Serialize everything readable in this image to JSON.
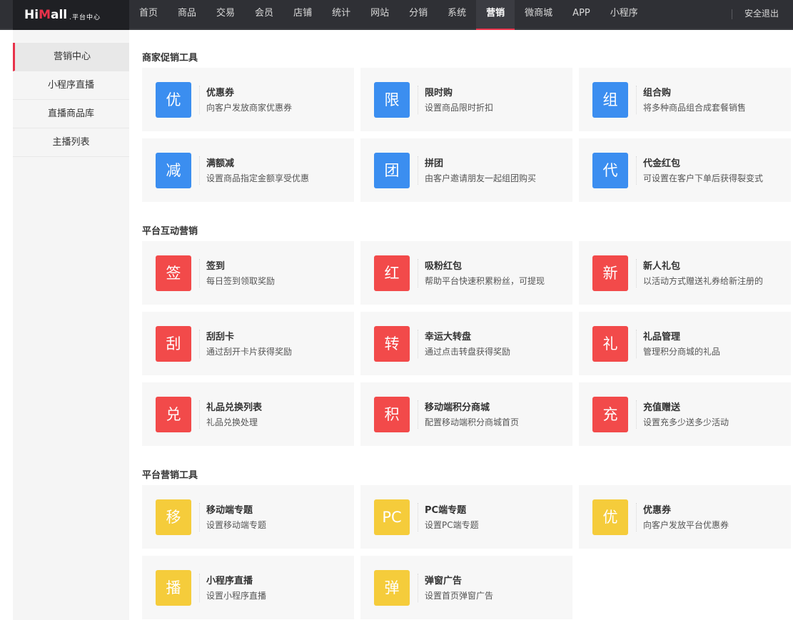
{
  "header": {
    "logo_brand_a": "Hi",
    "logo_brand_b": "M",
    "logo_brand_c": "all",
    "logo_suffix": ".平台中心",
    "nav": [
      "首页",
      "商品",
      "交易",
      "会员",
      "店铺",
      "统计",
      "网站",
      "分销",
      "系统",
      "营销",
      "微商城",
      "APP",
      "小程序"
    ],
    "active_nav": "营销",
    "logout": "安全退出"
  },
  "sidebar": {
    "items": [
      "营销中心",
      "小程序直播",
      "直播商品库",
      "主播列表"
    ],
    "active": "营销中心"
  },
  "sections": [
    {
      "title": "商家促销工具",
      "color": "#3b8ef0",
      "cards": [
        {
          "icon": "优",
          "icon_name": "coupon-icon",
          "title": "优惠券",
          "desc": "向客户发放商家优惠券"
        },
        {
          "icon": "限",
          "icon_name": "flash-sale-icon",
          "title": "限时购",
          "desc": "设置商品限时折扣"
        },
        {
          "icon": "组",
          "icon_name": "bundle-icon",
          "title": "组合购",
          "desc": "将多种商品组合成套餐销售"
        },
        {
          "icon": "减",
          "icon_name": "discount-icon",
          "title": "满额减",
          "desc": "设置商品指定金额享受优惠"
        },
        {
          "icon": "团",
          "icon_name": "group-buy-icon",
          "title": "拼团",
          "desc": "由客户邀请朋友一起组团购买"
        },
        {
          "icon": "代",
          "icon_name": "voucher-icon",
          "title": "代金红包",
          "desc": "可设置在客户下单后获得裂变式"
        }
      ]
    },
    {
      "title": "平台互动营销",
      "color": "#f24a4a",
      "cards": [
        {
          "icon": "签",
          "icon_name": "sign-in-icon",
          "title": "签到",
          "desc": "每日签到领取奖励"
        },
        {
          "icon": "红",
          "icon_name": "red-packet-icon",
          "title": "吸粉红包",
          "desc": "帮助平台快速积累粉丝，可提现"
        },
        {
          "icon": "新",
          "icon_name": "new-user-gift-icon",
          "title": "新人礼包",
          "desc": "以活动方式赠送礼券给新注册的"
        },
        {
          "icon": "刮",
          "icon_name": "scratch-card-icon",
          "title": "刮刮卡",
          "desc": "通过刮开卡片获得奖励"
        },
        {
          "icon": "转",
          "icon_name": "lucky-wheel-icon",
          "title": "幸运大转盘",
          "desc": "通过点击转盘获得奖励"
        },
        {
          "icon": "礼",
          "icon_name": "gift-icon",
          "title": "礼品管理",
          "desc": "管理积分商城的礼品"
        },
        {
          "icon": "兑",
          "icon_name": "exchange-icon",
          "title": "礼品兑换列表",
          "desc": "礼品兑换处理"
        },
        {
          "icon": "积",
          "icon_name": "points-mall-icon",
          "title": "移动端积分商城",
          "desc": "配置移动端积分商城首页"
        },
        {
          "icon": "充",
          "icon_name": "recharge-icon",
          "title": "充值赠送",
          "desc": "设置充多少送多少活动"
        }
      ]
    },
    {
      "title": "平台营销工具",
      "color": "#f5cc3b",
      "cards": [
        {
          "icon": "移",
          "icon_name": "mobile-topic-icon",
          "title": "移动端专题",
          "desc": "设置移动端专题"
        },
        {
          "icon": "PC",
          "icon_name": "pc-topic-icon",
          "title": "PC端专题",
          "desc": "设置PC端专题"
        },
        {
          "icon": "优",
          "icon_name": "platform-coupon-icon",
          "title": "优惠券",
          "desc": "向客户发放平台优惠券"
        },
        {
          "icon": "播",
          "icon_name": "live-stream-icon",
          "title": "小程序直播",
          "desc": "设置小程序直播"
        },
        {
          "icon": "弹",
          "icon_name": "popup-ad-icon",
          "title": "弹窗广告",
          "desc": "设置首页弹窗广告"
        }
      ]
    }
  ]
}
